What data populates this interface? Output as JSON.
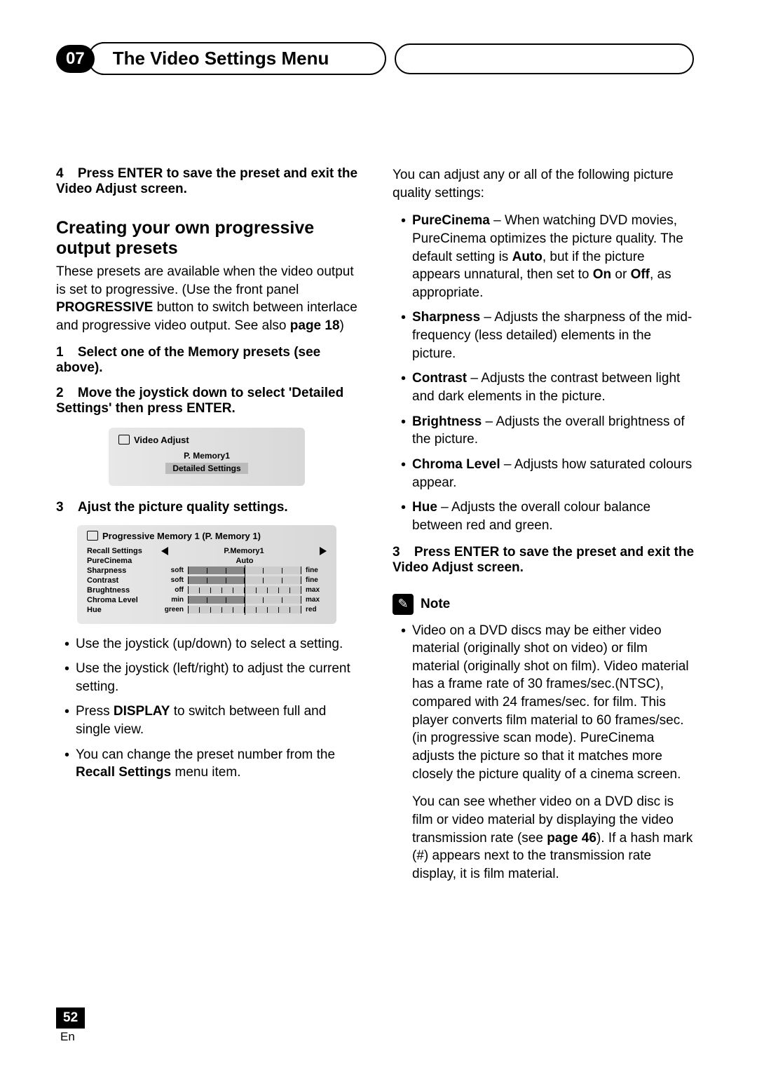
{
  "header": {
    "chapter_num": "07",
    "chapter_title": "The Video Settings Menu"
  },
  "left": {
    "step4_num": "4",
    "step4_text": "Press ENTER to save the preset and exit the Video Adjust screen.",
    "heading": "Creating your own progressive output presets",
    "intro_p1a": "These presets are available when the video output is set to progressive. (Use the front panel ",
    "intro_p1b": "PROGRESSIVE",
    "intro_p1c": " button to switch between interlace and progressive video output. See also ",
    "intro_p1d": "page 18",
    "intro_p1e": ")",
    "step1_num": "1",
    "step1_text": "Select one of the Memory presets (see above).",
    "step2_num": "2",
    "step2_text": "Move the joystick down to select 'Detailed Settings' then press ENTER.",
    "step3_num": "3",
    "step3_text": "Ajust the picture quality settings.",
    "osd1": {
      "title": "Video Adjust",
      "line1": "P. Memory1",
      "line2": "Detailed Settings"
    },
    "osd2": {
      "title": "Progressive Memory 1 (P. Memory 1)",
      "rows": {
        "recall": "Recall Settings",
        "recall_val": "P.Memory1",
        "purecinema": "PureCinema",
        "purecinema_val": "Auto",
        "sharpness": "Sharpness",
        "sharp_l": "soft",
        "sharp_r": "fine",
        "contrast": "Contrast",
        "con_l": "soft",
        "con_r": "fine",
        "brightness": "Brughtness",
        "bri_l": "off",
        "bri_r": "max",
        "chroma": "Chroma Level",
        "chr_l": "min",
        "chr_r": "max",
        "hue": "Hue",
        "hue_l": "green",
        "hue_r": "red"
      }
    },
    "bullets": {
      "b1": "Use the joystick (up/down) to select a setting.",
      "b2": "Use the joystick (left/right) to adjust the current setting.",
      "b3a": "Press ",
      "b3b": "DISPLAY",
      "b3c": " to switch between full and single view.",
      "b4a": "You can change the preset number from the ",
      "b4b": "Recall Settings",
      "b4c": " menu item."
    }
  },
  "right": {
    "intro": "You can adjust any or all of the following picture quality settings:",
    "items": {
      "purecinema_t": "PureCinema",
      "purecinema_1": " – When watching DVD movies, PureCinema optimizes the picture quality. The default setting is ",
      "purecinema_auto": "Auto",
      "purecinema_2": ", but if the picture appears unnatural, then set to ",
      "purecinema_on": "On",
      "purecinema_3": " or ",
      "purecinema_off": "Off",
      "purecinema_4": ", as appropriate.",
      "sharpness_t": "Sharpness",
      "sharpness": " – Adjusts the sharpness of the mid-frequency (less detailed) elements in the picture.",
      "contrast_t": "Contrast",
      "contrast": " – Adjusts the contrast between light and dark elements in the picture.",
      "brightness_t": "Brightness",
      "brightness": " – Adjusts the overall brightness of the picture.",
      "chroma_t": "Chroma Level",
      "chroma": " – Adjusts how saturated colours appear.",
      "hue_t": "Hue",
      "hue": " – Adjusts the overall colour balance between red and green."
    },
    "step3_num": "3",
    "step3_text": "Press ENTER to save the preset and exit the Video Adjust screen.",
    "note_label": "Note",
    "note1a": "Video on a DVD discs may be either video material (originally shot on video) or film material (originally shot on film). Video material has a frame rate of 30 frames/sec.(NTSC), compared with 24 frames/sec. for film. This player converts film material to 60 frames/sec. (in progressive scan mode). PureCinema adjusts the picture so that it matches more closely the picture quality of a cinema screen.",
    "note2a": "You can see whether video on a DVD disc is film or video material by displaying the video transmission rate (see ",
    "note2b": "page 46",
    "note2c": "). If a hash mark (#) appears next to the transmission rate display, it is film material."
  },
  "footer": {
    "page": "52",
    "lang": "En"
  }
}
